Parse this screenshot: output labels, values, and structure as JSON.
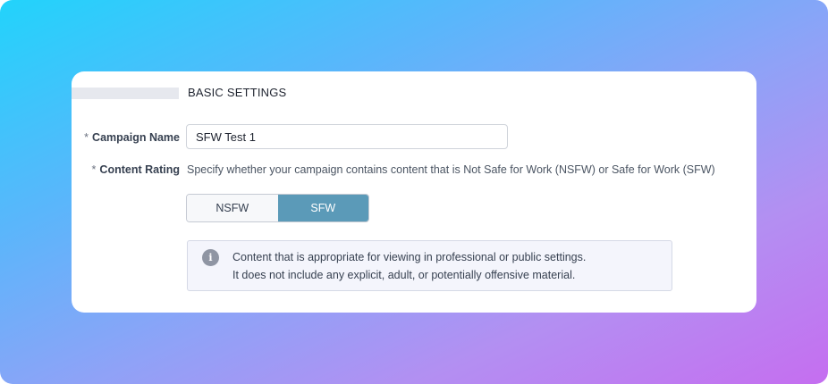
{
  "section": {
    "title": "BASIC SETTINGS"
  },
  "campaign_name": {
    "required_marker": "*",
    "label": "Campaign Name",
    "value": "SFW Test 1"
  },
  "content_rating": {
    "required_marker": "*",
    "label": "Content Rating",
    "help_text": "Specify whether your campaign contains content that is Not Safe for Work (NSFW) or Safe for Work (SFW)",
    "options": [
      "NSFW",
      "SFW"
    ],
    "selected": "SFW"
  },
  "info": {
    "icon": "info-icon",
    "glyph": "i",
    "line1": "Content that is appropriate for viewing in professional or public settings.",
    "line2": "It does not include any explicit, adult, or potentially offensive material."
  },
  "colors": {
    "selected_toggle": "#5b9ab8",
    "info_background": "#f4f5fc"
  }
}
